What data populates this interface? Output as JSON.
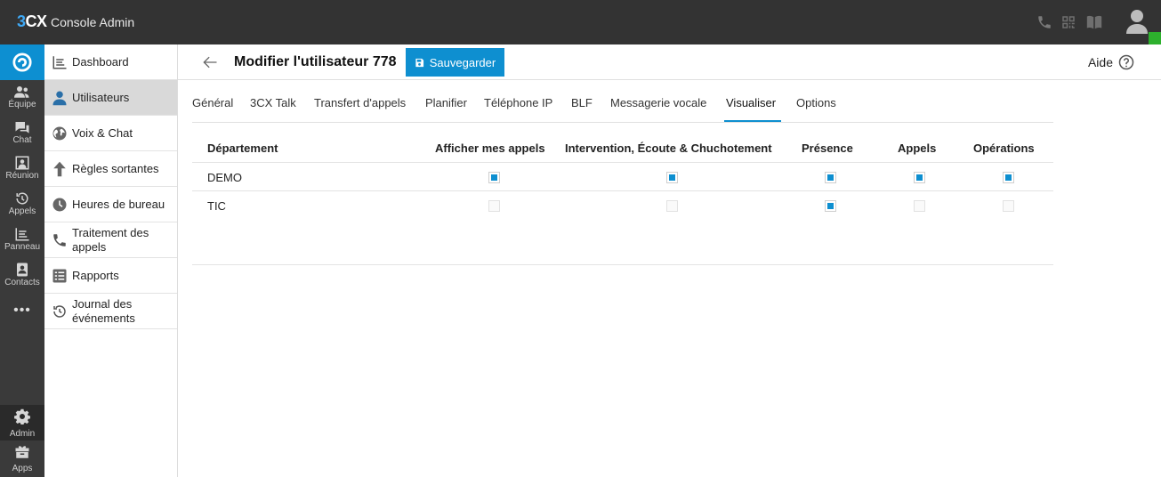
{
  "topbar": {
    "logo_three": "3",
    "logo_cx": "CX",
    "title": "Console Admin"
  },
  "rail": {
    "items": [
      {
        "label": "Équipe"
      },
      {
        "label": "Chat"
      },
      {
        "label": "Réunion"
      },
      {
        "label": "Appels"
      },
      {
        "label": "Panneau"
      },
      {
        "label": "Contacts"
      }
    ],
    "more": "•••",
    "admin_label": "Admin",
    "apps_label": "Apps"
  },
  "sidenav": {
    "items": [
      {
        "label": "Dashboard"
      },
      {
        "label": "Utilisateurs"
      },
      {
        "label": "Voix & Chat"
      },
      {
        "label": "Règles sortantes"
      },
      {
        "label": "Heures de bureau"
      },
      {
        "label": "Traitement des appels"
      },
      {
        "label": "Rapports"
      },
      {
        "label": "Journal des événements"
      }
    ]
  },
  "header": {
    "title": "Modifier l'utilisateur 778",
    "save_label": "Sauvegarder",
    "help_label": "Aide"
  },
  "tabs": [
    {
      "label": "Général"
    },
    {
      "label": "3CX Talk"
    },
    {
      "label": "Transfert d'appels"
    },
    {
      "label": "Planifier"
    },
    {
      "label": "Téléphone IP"
    },
    {
      "label": "BLF"
    },
    {
      "label": "Messagerie vocale"
    },
    {
      "label": "Visualiser"
    },
    {
      "label": "Options"
    }
  ],
  "active_tab": "Visualiser",
  "table": {
    "columns": [
      "Département",
      "Afficher mes appels",
      "Intervention, Écoute & Chuchotement",
      "Présence",
      "Appels",
      "Opérations"
    ],
    "rows": [
      {
        "name": "DEMO",
        "checks": [
          true,
          true,
          true,
          true,
          true
        ]
      },
      {
        "name": "TIC",
        "checks": [
          false,
          false,
          true,
          false,
          false
        ]
      }
    ]
  },
  "colors": {
    "accent": "#0e8fd0",
    "topbar": "#333333",
    "rail": "#3a3a3a",
    "status": "#2db02d"
  }
}
